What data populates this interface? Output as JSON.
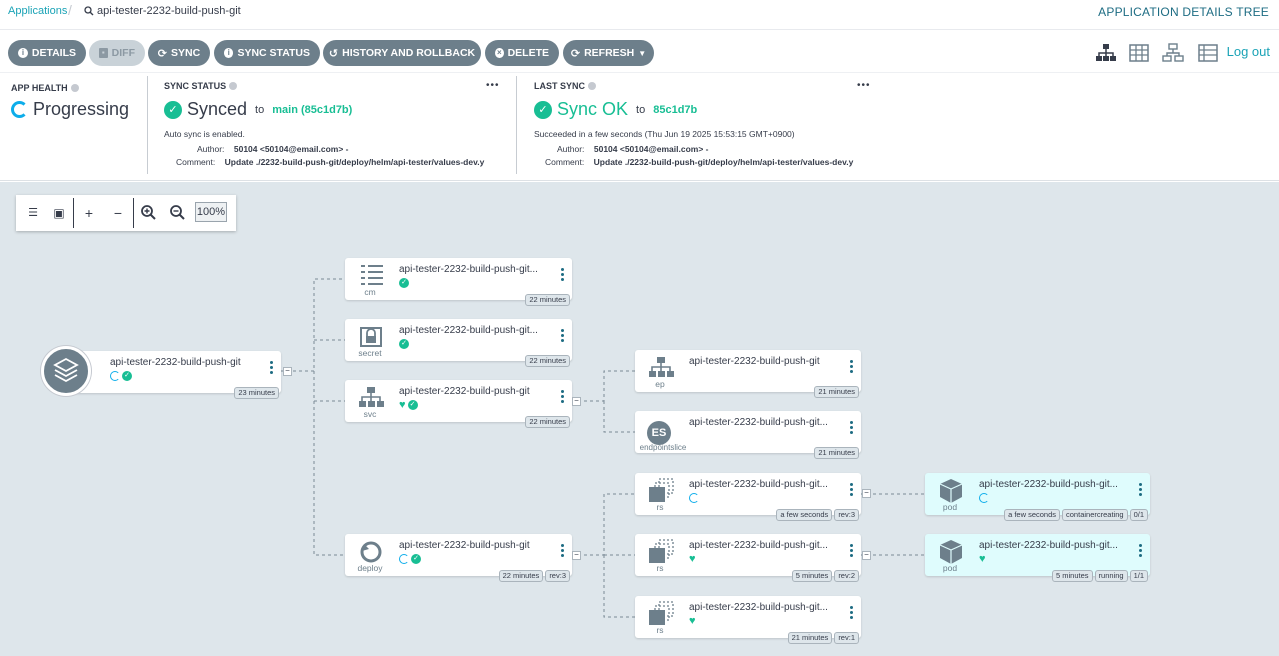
{
  "breadcrumb": {
    "applications": "Applications",
    "current": "api-tester-2232-build-push-git"
  },
  "page_title": "APPLICATION DETAILS TREE",
  "toolbar": {
    "details": "DETAILS",
    "diff": "DIFF",
    "sync": "SYNC",
    "sync_status": "SYNC STATUS",
    "history": "HISTORY AND ROLLBACK",
    "delete": "DELETE",
    "refresh": "REFRESH",
    "logout": "Log out"
  },
  "status": {
    "app_health_label": "APP HEALTH",
    "app_health_value": "Progressing",
    "sync_status_label": "SYNC STATUS",
    "sync_status_value": "Synced",
    "sync_to": "to",
    "sync_target": "main (85c1d7b)",
    "auto_sync": "Auto sync is enabled.",
    "author_label": "Author:",
    "author": "50104 <50104@email.com> -",
    "comment_label": "Comment:",
    "comment": "Update ./2232-build-push-git/deploy/helm/api-tester/values-dev.y",
    "last_sync_label": "LAST SYNC",
    "last_sync_value": "Sync OK",
    "last_sync_to": "to",
    "last_sync_rev": "85c1d7b",
    "last_sync_detail": "Succeeded in a few seconds (Thu Jun 19 2025 15:53:15 GMT+0900)",
    "ls_author_label": "Author:",
    "ls_author": "50104 <50104@email.com> -",
    "ls_comment_label": "Comment:",
    "ls_comment": "Update ./2232-build-push-git/deploy/helm/api-tester/values-dev.y",
    "more": "•••"
  },
  "zoom": {
    "level": "100%"
  },
  "app_node": {
    "name": "api-tester-2232-build-push-git",
    "age": "23 minutes"
  },
  "nodes": [
    {
      "name": "api-tester-2232-build-push-git...",
      "kind": "cm",
      "tags": [
        "22 minutes"
      ]
    },
    {
      "name": "api-tester-2232-build-push-git...",
      "kind": "secret",
      "tags": [
        "22 minutes"
      ]
    },
    {
      "name": "api-tester-2232-build-push-git",
      "kind": "svc",
      "tags": [
        "22 minutes"
      ]
    },
    {
      "name": "api-tester-2232-build-push-git",
      "kind": "deploy",
      "tags": [
        "22 minutes",
        "rev:3"
      ]
    },
    {
      "name": "api-tester-2232-build-push-git",
      "kind": "ep",
      "tags": [
        "21 minutes"
      ]
    },
    {
      "name": "api-tester-2232-build-push-git...",
      "kind": "endpointslice",
      "icon_text": "ES",
      "tags": [
        "21 minutes"
      ]
    },
    {
      "name": "api-tester-2232-build-push-git...",
      "kind": "rs",
      "tags": [
        "a few seconds",
        "rev:3"
      ]
    },
    {
      "name": "api-tester-2232-build-push-git...",
      "kind": "rs",
      "tags": [
        "5 minutes",
        "rev:2"
      ]
    },
    {
      "name": "api-tester-2232-build-push-git...",
      "kind": "rs",
      "tags": [
        "21 minutes",
        "rev:1"
      ]
    },
    {
      "name": "api-tester-2232-build-push-git...",
      "kind": "pod",
      "tags": [
        "a few seconds",
        "containercreating",
        "0/1"
      ]
    },
    {
      "name": "api-tester-2232-build-push-git...",
      "kind": "pod",
      "tags": [
        "5 minutes",
        "running",
        "1/1"
      ]
    }
  ],
  "colors": {
    "accent": "#1aa3b6",
    "healthy": "#18be94",
    "progressing": "#0dadea",
    "button": "#6d7f8b"
  }
}
